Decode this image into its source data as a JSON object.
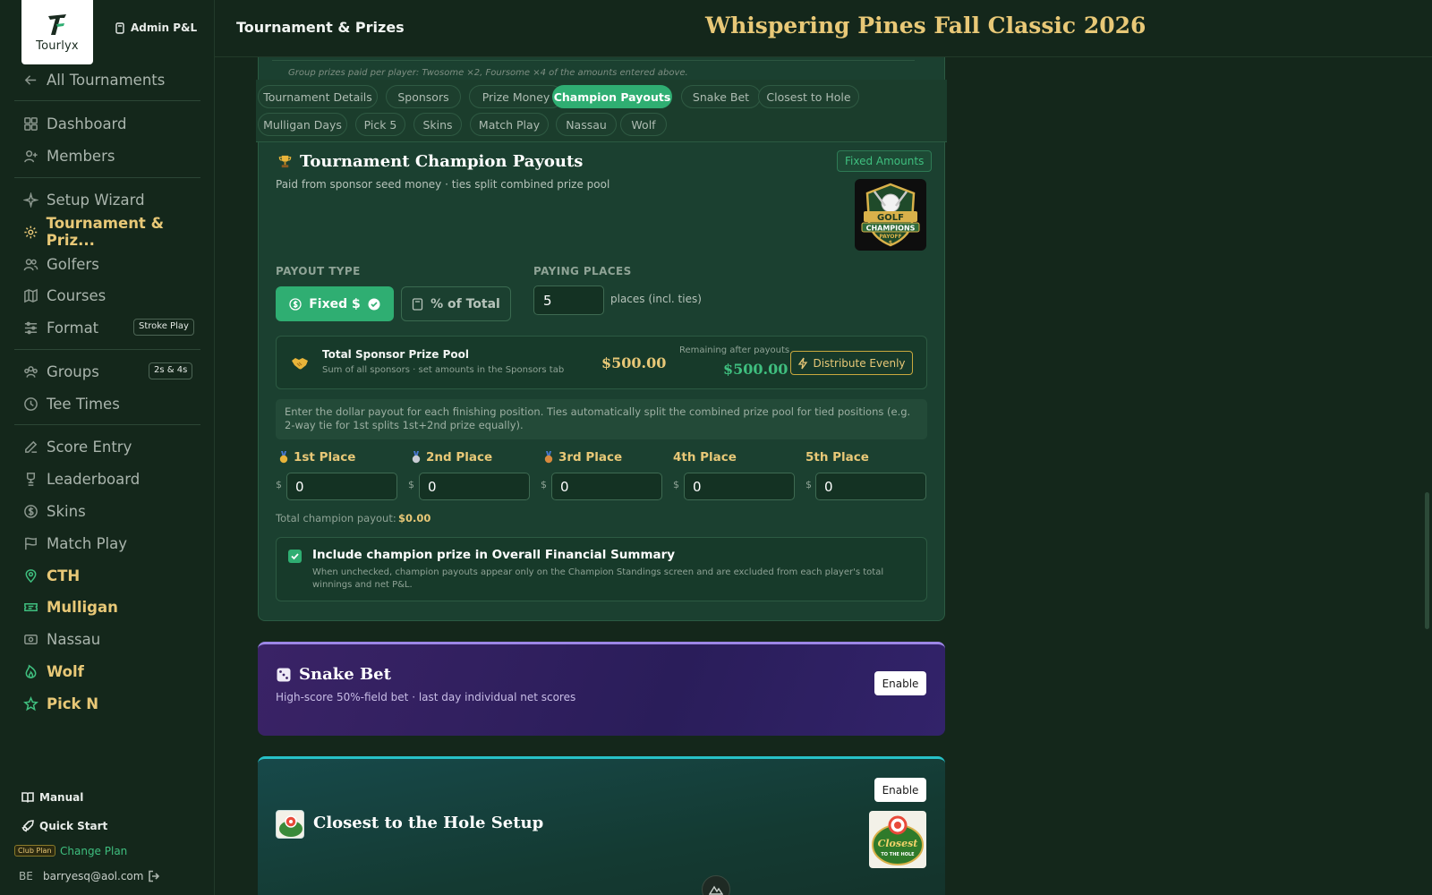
{
  "app": {
    "logo_text": "Tourlyx",
    "admin_label": "Admin P&L"
  },
  "header": {
    "title": "Tournament & Prizes",
    "tournament_name": "Whispering Pines Fall Classic 2026"
  },
  "sidebar": {
    "back": "All Tournaments",
    "items": [
      {
        "label": "Dashboard",
        "icon": "grid-icon"
      },
      {
        "label": "Members",
        "icon": "user-plus-icon"
      },
      {
        "label": "Setup Wizard",
        "icon": "sparkle-icon"
      },
      {
        "label": "Tournament & Priz...",
        "icon": "gear-icon"
      },
      {
        "label": "Golfers",
        "icon": "users-icon"
      },
      {
        "label": "Courses",
        "icon": "map-icon"
      },
      {
        "label": "Format",
        "icon": "sliders-icon",
        "badge": "Stroke Play"
      },
      {
        "label": "Groups",
        "icon": "group-icon",
        "badge": "2s & 4s"
      },
      {
        "label": "Tee Times",
        "icon": "clock-icon"
      },
      {
        "label": "Score Entry",
        "icon": "edit-icon"
      },
      {
        "label": "Leaderboard",
        "icon": "trophy-icon"
      },
      {
        "label": "Skins",
        "icon": "dollar-icon"
      },
      {
        "label": "Match Play",
        "icon": "flag-icon"
      },
      {
        "label": "CTH",
        "icon": "pin-icon"
      },
      {
        "label": "Mulligan",
        "icon": "ticket-icon"
      },
      {
        "label": "Nassau",
        "icon": "cash-icon"
      },
      {
        "label": "Wolf",
        "icon": "flame-icon"
      },
      {
        "label": "Pick N",
        "icon": "star-icon"
      }
    ],
    "footer": {
      "manual": "Manual",
      "quick_start": "Quick Start",
      "plan_badge": "Club Plan",
      "change_plan": "Change Plan",
      "user_initials": "BE",
      "user_email": "barryesq@aol.com"
    }
  },
  "group_note": "Group prizes paid per player: Twosome ×2, Foursome ×4 of the amounts entered above.",
  "tabs": [
    "Tournament Details",
    "Sponsors",
    "Prize Money",
    "Champion Payouts",
    "Snake Bet",
    "Closest to Hole",
    "Mulligan Days",
    "Pick 5",
    "Skins",
    "Match Play",
    "Nassau",
    "Wolf"
  ],
  "active_tab": "Champion Payouts",
  "champion": {
    "title": "Tournament Champion Payouts",
    "subtitle": "Paid from sponsor seed money · ties split combined prize pool",
    "badge": "Fixed Amounts",
    "logo_text": [
      "GOLF",
      "CHAMPIONS",
      "PAYOFF",
      "$"
    ],
    "payout_type_label": "PAYOUT TYPE",
    "fixed_label": "Fixed $",
    "percent_label": "% of Total",
    "paying_places_label": "PAYING PLACES",
    "paying_places_value": "5",
    "places_suffix": "places (incl. ties)",
    "pool": {
      "title": "Total Sponsor Prize Pool",
      "subtitle": "Sum of all sponsors · set amounts in the Sponsors tab",
      "amount": "$500.00",
      "remaining_label": "Remaining after payouts",
      "remaining_amount": "$500.00",
      "distribute_label": "Distribute Evenly"
    },
    "info": "Enter the dollar payout for each finishing position. Ties automatically split the combined prize pool for tied positions (e.g. 2-way tie for 1st splits 1st+2nd prize equally).",
    "places": [
      {
        "label": "1st Place",
        "medal": "gold",
        "value": "0"
      },
      {
        "label": "2nd Place",
        "medal": "silver",
        "value": "0"
      },
      {
        "label": "3rd Place",
        "medal": "bronze",
        "value": "0"
      },
      {
        "label": "4th Place",
        "medal": "",
        "value": "0"
      },
      {
        "label": "5th Place",
        "medal": "",
        "value": "0"
      }
    ],
    "currency": "$",
    "total_label": "Total champion payout:",
    "total_value": "$0.00",
    "include": {
      "title": "Include champion prize in Overall Financial Summary",
      "description": "When unchecked, champion payouts appear only on the Champion Standings screen and are excluded from each player's total winnings and net P&L.",
      "checked": true
    }
  },
  "snake": {
    "title": "Snake Bet",
    "subtitle": "High-score 50%-field bet · last day individual net scores",
    "enable_label": "Enable"
  },
  "cth": {
    "title": "Closest to the Hole Setup",
    "enable_label": "Enable",
    "logo_text": [
      "Closest",
      "TO THE HOLE"
    ]
  },
  "colors": {
    "accent_green": "#2fae72",
    "gold": "#e8c877",
    "background": "#14271b",
    "snake_purple": "#2a1d5a",
    "cth_teal": "#17494a"
  }
}
